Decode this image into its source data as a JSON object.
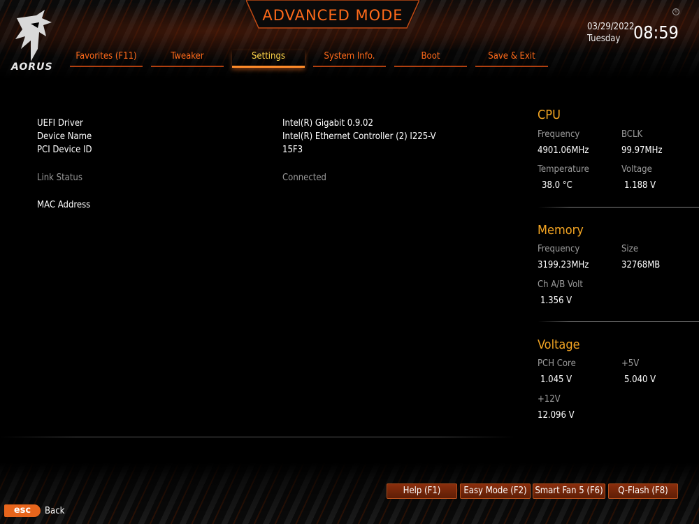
{
  "brand": {
    "logo_text": "AORUS"
  },
  "header": {
    "title": "ADVANCED MODE",
    "date": "03/29/2022",
    "day": "Tuesday",
    "time": "08:59",
    "copyright_symbol": "©"
  },
  "tabs": [
    {
      "label": "Favorites (F11)",
      "active": false
    },
    {
      "label": "Tweaker",
      "active": false
    },
    {
      "label": "Settings",
      "active": true
    },
    {
      "label": "System Info.",
      "active": false
    },
    {
      "label": "Boot",
      "active": false
    },
    {
      "label": "Save & Exit",
      "active": false
    }
  ],
  "details": {
    "uefi_driver": {
      "label": "UEFI Driver",
      "value": "Intel(R) Gigabit 0.9.02"
    },
    "device_name": {
      "label": "Device Name",
      "value": "Intel(R) Ethernet Controller (2) I225-V"
    },
    "pci_device_id": {
      "label": "PCI Device ID",
      "value": "15F3"
    },
    "link_status": {
      "label": "Link Status",
      "value": "Connected"
    },
    "mac_address": {
      "label": "MAC Address",
      "value": ""
    }
  },
  "cpu": {
    "title": "CPU",
    "frequency_label": "Frequency",
    "frequency": "4901.06MHz",
    "bclk_label": "BCLK",
    "bclk": "99.97MHz",
    "temperature_label": "Temperature",
    "temperature": "38.0 °C",
    "voltage_label": "Voltage",
    "voltage": "1.188 V"
  },
  "memory": {
    "title": "Memory",
    "frequency_label": "Frequency",
    "frequency": "3199.23MHz",
    "size_label": "Size",
    "size": "32768MB",
    "ch_volt_label": "Ch A/B Volt",
    "ch_volt": "1.356 V"
  },
  "voltage": {
    "title": "Voltage",
    "pch_core_label": "PCH Core",
    "pch_core": "1.045 V",
    "plus5_label": "+5V",
    "plus5": "5.040 V",
    "plus12_label": "+12V",
    "plus12": "12.096 V"
  },
  "footer": {
    "help": "Help (F1)",
    "easy_mode": "Easy Mode (F2)",
    "smart_fan": "Smart Fan 5 (F6)",
    "qflash": "Q-Flash (F8)",
    "esc": "esc",
    "back": "Back"
  },
  "colors": {
    "accent": "#ff6a1a",
    "active_tab": "#ffd54a",
    "panel_title": "#f5a623"
  }
}
